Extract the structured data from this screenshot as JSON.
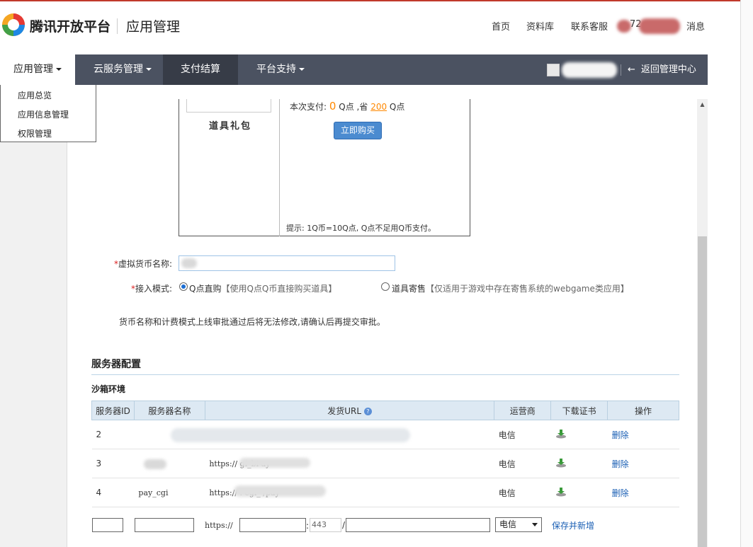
{
  "header": {
    "logo_text": "腾讯开放平台",
    "section_title": "应用管理",
    "links": [
      "首页",
      "资料库",
      "联系客服"
    ],
    "user_fragment": "72",
    "messages": "消息"
  },
  "navbar": {
    "items": [
      {
        "label": "应用管理",
        "dropdown": true
      },
      {
        "label": "云服务管理",
        "dropdown": true
      },
      {
        "label": "支付结算",
        "dropdown": false
      },
      {
        "label": "平台支持",
        "dropdown": true
      }
    ],
    "back": "返回管理中心"
  },
  "dropdown": {
    "items": [
      "应用总览",
      "应用信息管理",
      "权限管理"
    ]
  },
  "gift": {
    "name": "道具礼包",
    "pay_label": "本次支付:",
    "pay_value": "0",
    "pay_unit": "Q点",
    "save_label": ",省",
    "save_value": "200",
    "save_unit": "Q点",
    "buy_button": "立即购买",
    "tip": "提示: 1Q币=10Q点, Q点不足用Q币支付。"
  },
  "form": {
    "currency_label": "虚拟货币名称:",
    "mode_label": "接入模式:",
    "option1": "Q点直购",
    "option1_hint": "【使用Q点Q币直接购买道具】",
    "option2": "道具寄售",
    "option2_hint": "【仅适用于游戏中存在寄售系统的webgame类应用】",
    "notice": "货币名称和计费模式上线审批通过后将无法修改,请确认后再提交审批。"
  },
  "server": {
    "section_title": "服务器配置",
    "env_title": "沙箱环境",
    "columns": [
      "服务器ID",
      "服务器名称",
      "发货URL",
      "运营商",
      "下载证书",
      "操作"
    ],
    "rows": [
      {
        "id": "2",
        "name": "",
        "url": "",
        "carrier": "电信",
        "action": "删除"
      },
      {
        "id": "3",
        "name": "",
        "url": "https://                gi_bi   ay",
        "carrier": "电信",
        "action": "删除"
      },
      {
        "id": "4",
        "name": "pay_cgi",
        "url": "https://        .       cgi_  /pay",
        "carrier": "电信",
        "action": "删除"
      }
    ],
    "new_row": {
      "url_prefix": "https://",
      "port_placeholder": "443",
      "slash": "/",
      "carrier": "电信",
      "save_button": "保存并新增"
    }
  },
  "colors": {
    "nav_bg": "#4b5261",
    "nav_active_bg": "#373c47",
    "link": "#1a5fb4",
    "accent_orange": "#ff8800",
    "table_header_bg": "#dde9f3"
  }
}
